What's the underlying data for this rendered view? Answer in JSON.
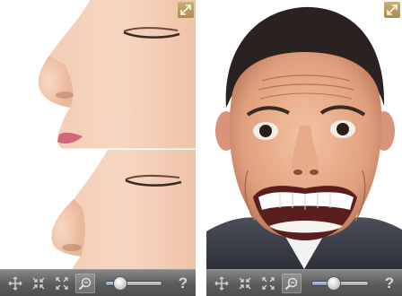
{
  "screens": [
    {
      "name": "nose-editor",
      "toolbar": {
        "tools": [
          "move-icon",
          "pinch-icon",
          "expand-icon",
          "zoom-icon"
        ],
        "slider_fraction": 0.25,
        "help_label": "?"
      }
    },
    {
      "name": "face-editor",
      "toolbar": {
        "tools": [
          "move-icon",
          "pinch-icon",
          "expand-icon",
          "zoom-icon"
        ],
        "slider_fraction": 0.38,
        "help_label": "?"
      }
    }
  ],
  "colors": {
    "toolbar": "#5c5c5c",
    "expand_button": "#b79a5c",
    "slider_fill": "#6f95c4",
    "skin": "#f0c2a6"
  }
}
